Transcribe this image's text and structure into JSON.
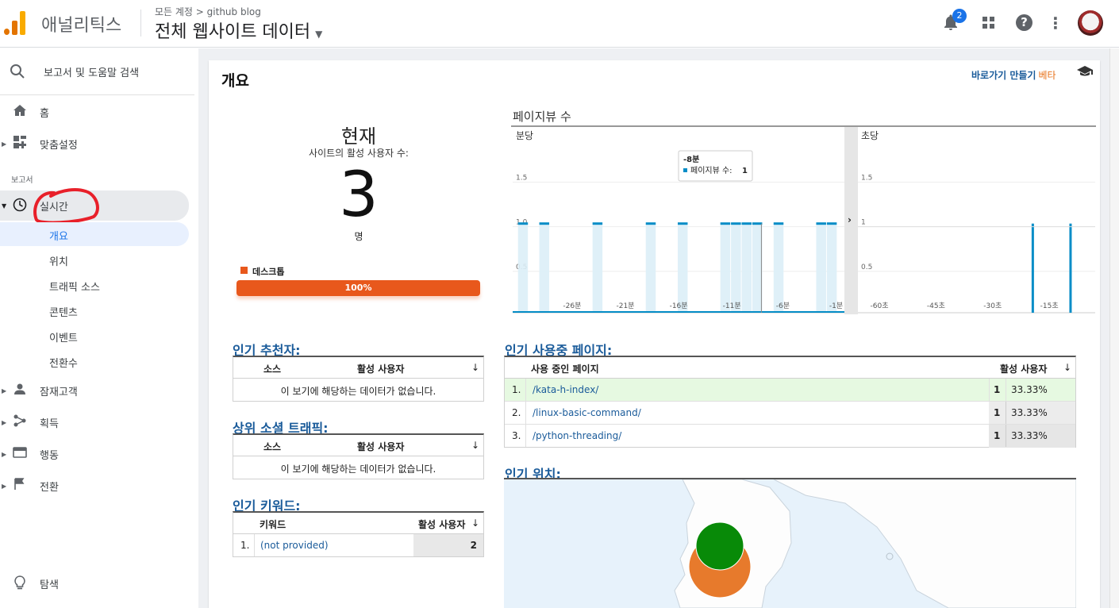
{
  "header": {
    "app_name": "애널리틱스",
    "breadcrumb": "모든 계정 > github blog",
    "view_title": "전체 웹사이트 데이터",
    "notification_count": "2"
  },
  "sidebar": {
    "search_placeholder": "보고서 및 도움말 검색",
    "home": "홈",
    "customize": "맞춤설정",
    "reports_label": "보고서",
    "realtime": "실시간",
    "realtime_sub": [
      "개요",
      "위치",
      "트래픽 소스",
      "콘텐츠",
      "이벤트",
      "전환수"
    ],
    "audience": "잠재고객",
    "acquisition": "획득",
    "behavior": "행동",
    "conversions": "전환",
    "discover": "탐색"
  },
  "main": {
    "title": "개요",
    "shortcut": "바로가기 만들기",
    "beta": "베타",
    "now_label": "현재",
    "active_users_label": "사이트의 활성 사용자 수:",
    "active_users": "3",
    "unit": "명",
    "device_label": "데스크톱",
    "device_pct": "100%"
  },
  "chart_data": {
    "type": "bar",
    "title": "페이지뷰 수",
    "panels": [
      {
        "name": "분당",
        "ylim": [
          0,
          1.5
        ],
        "yticks": [
          "1.5",
          "1.0",
          "0.5"
        ],
        "xticks": [
          "-26분",
          "-21분",
          "-16분",
          "-11분",
          "-6분",
          "-1분"
        ],
        "series": [
          {
            "name": "페이지뷰 수",
            "x_minutes": [
              -30,
              -28,
              -23,
              -18,
              -15,
              -11,
              -10,
              -9,
              -8,
              -6,
              -2,
              -1
            ],
            "values": [
              1,
              1,
              1,
              1,
              1,
              1,
              1,
              1,
              1,
              1,
              1,
              1
            ]
          }
        ]
      },
      {
        "name": "초당",
        "ylim": [
          0,
          1.5
        ],
        "yticks": [
          "1.5",
          "1",
          "0.5"
        ],
        "xticks": [
          "-60초",
          "-45초",
          "-30초",
          "-15초"
        ],
        "series": [
          {
            "name": "페이지뷰 수",
            "x_seconds": [
              -16,
              -6
            ],
            "values": [
              1,
              1
            ]
          }
        ]
      }
    ],
    "tooltip": {
      "title": "-8분",
      "label": "페이지뷰 수:",
      "value": "1"
    },
    "color": "#058dc7"
  },
  "referrers": {
    "title": "인기 추천자:",
    "col_source": "소스",
    "col_users": "활성 사용자",
    "empty": "이 보기에 해당하는 데이터가 없습니다."
  },
  "social": {
    "title": "상위 소셜 트래픽:",
    "col_source": "소스",
    "col_users": "활성 사용자",
    "empty": "이 보기에 해당하는 데이터가 없습니다."
  },
  "keywords": {
    "title": "인기 키워드:",
    "col_keyword": "키워드",
    "col_users": "활성 사용자",
    "rows": [
      {
        "idx": "1.",
        "keyword": "(not provided)",
        "users": "2"
      }
    ]
  },
  "pages": {
    "title": "인기 사용중 페이지:",
    "col_page": "사용 중인 페이지",
    "col_users": "활성 사용자",
    "rows": [
      {
        "idx": "1.",
        "page": "/kata-h-index/",
        "users": "1",
        "pct": "33.33%"
      },
      {
        "idx": "2.",
        "page": "/linux-basic-command/",
        "users": "1",
        "pct": "33.33%"
      },
      {
        "idx": "3.",
        "page": "/python-threading/",
        "users": "1",
        "pct": "33.33%"
      }
    ]
  },
  "locations": {
    "title": "인기 위치:"
  }
}
